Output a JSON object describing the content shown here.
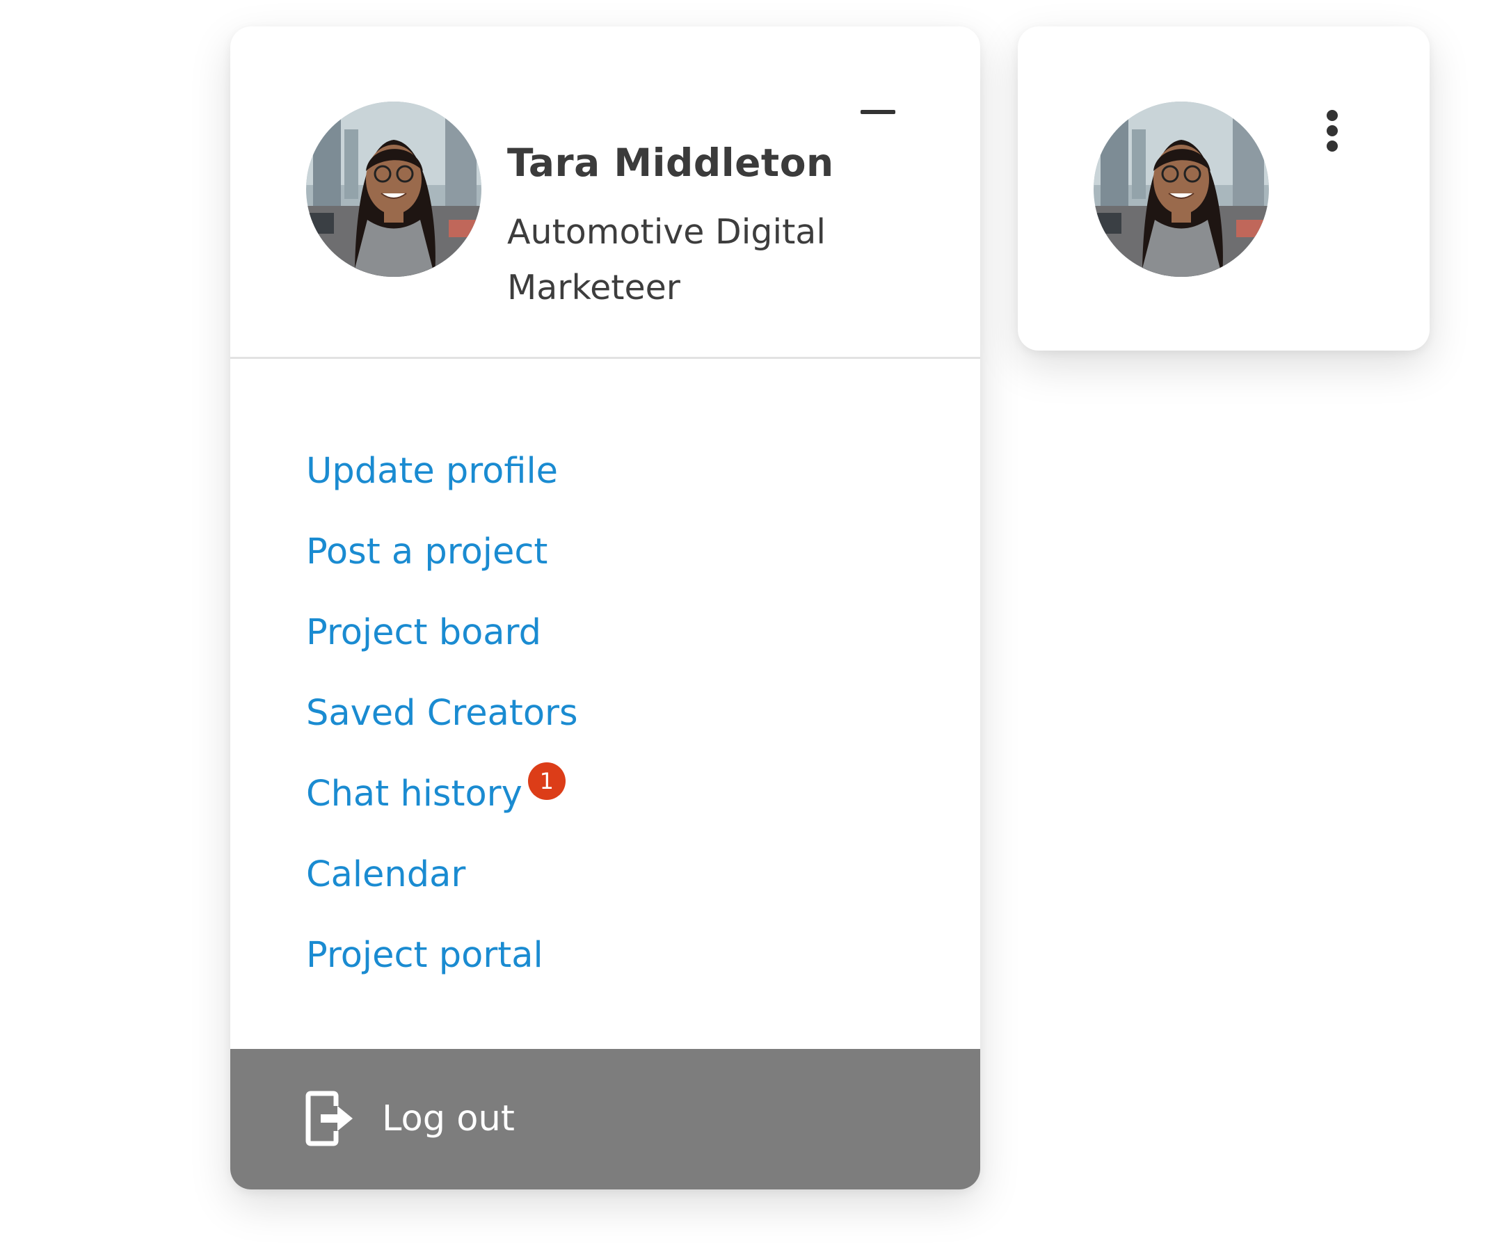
{
  "profile": {
    "name": "Tara Middleton",
    "role": "Automotive Digital\nMarketeer",
    "avatar_icon": "avatar-photo"
  },
  "header": {
    "collapse_icon": "minus-icon"
  },
  "menu": {
    "items": [
      {
        "label": "Update profile"
      },
      {
        "label": "Post a project"
      },
      {
        "label": "Project board"
      },
      {
        "label": "Saved Creators"
      },
      {
        "label": "Chat history",
        "badge": "1"
      },
      {
        "label": "Calendar"
      },
      {
        "label": "Project portal"
      }
    ]
  },
  "logout": {
    "label": "Log out",
    "icon": "logout-icon"
  },
  "collapsed_card": {
    "menu_icon": "kebab-menu-icon"
  },
  "colors": {
    "link": "#1a8bd1",
    "badge": "#dc3d18",
    "logout_bar": "#7d7d7d",
    "text_dark": "#3b3b3b"
  }
}
